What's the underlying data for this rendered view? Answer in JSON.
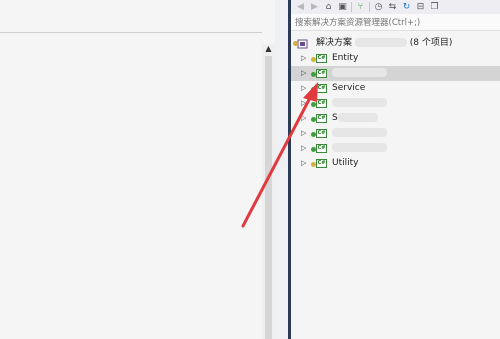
{
  "explorer": {
    "search_placeholder": "搜索解决方案资源管理器(Ctrl+;)",
    "solution": {
      "label_prefix": "解决方案",
      "label_suffix": "(8 个项目)"
    },
    "projects": [
      {
        "name": "Entity",
        "dot": "#d4b13c"
      },
      {
        "name": "",
        "dot": "#3f9d3f",
        "selected": true
      },
      {
        "name": "Service",
        "dot": "#3f9d3f"
      },
      {
        "name": "",
        "dot": "#3f9d3f"
      },
      {
        "name": "S",
        "dot": "#3f9d3f"
      },
      {
        "name": "",
        "dot": "#3f9d3f"
      },
      {
        "name": "",
        "dot": "#3f9d3f"
      },
      {
        "name": "Utility",
        "dot": "#d4b13c"
      }
    ],
    "project_icon_text": "C#"
  },
  "toolbar_icons": [
    "back-icon",
    "forward-icon",
    "home-icon",
    "sync-view-icon",
    "git-icon",
    "history-icon",
    "switch-view-icon",
    "refresh-icon",
    "collapse-all-icon",
    "show-all-files-icon"
  ],
  "colors": {
    "annotation_arrow": "#e0393e",
    "divider": "#2b3a55"
  }
}
